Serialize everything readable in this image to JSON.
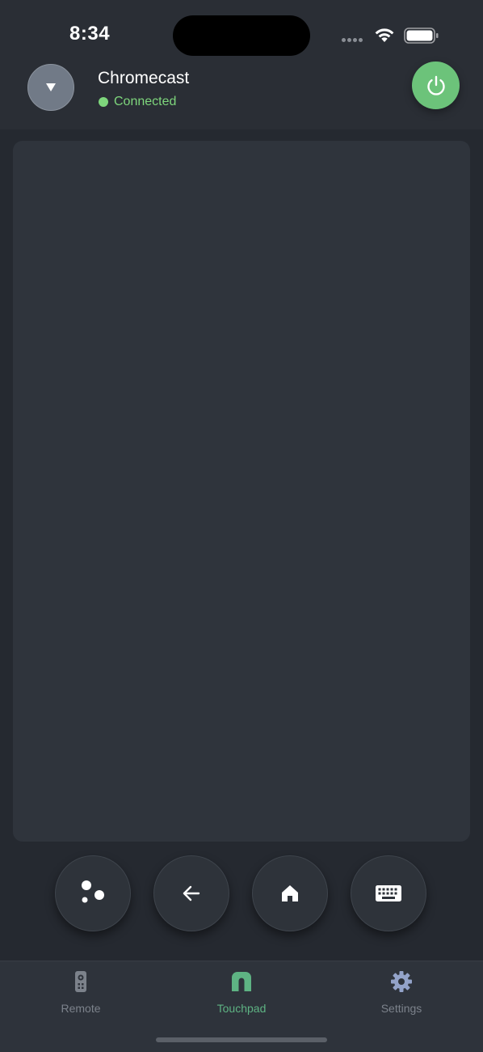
{
  "status_bar": {
    "time": "8:34"
  },
  "header": {
    "device_name": "Chromecast",
    "device_status": "Connected"
  },
  "colors": {
    "accent_green": "#6cc37a",
    "status_green": "#7ed67c",
    "tab_active": "#5eb383",
    "tab_inactive": "#7c828b",
    "background": "#2a2e35",
    "touchpad": "#2f343c"
  },
  "actions": [
    {
      "name": "assistant-button",
      "icon": "assistant-dots-icon"
    },
    {
      "name": "back-button",
      "icon": "arrow-left-icon"
    },
    {
      "name": "home-button",
      "icon": "home-icon"
    },
    {
      "name": "keyboard-button",
      "icon": "keyboard-icon"
    }
  ],
  "tabs": {
    "remote": {
      "label": "Remote",
      "icon": "remote-icon"
    },
    "touchpad": {
      "label": "Touchpad",
      "icon": "touchpad-icon",
      "active": true
    },
    "settings": {
      "label": "Settings",
      "icon": "gear-icon"
    }
  }
}
